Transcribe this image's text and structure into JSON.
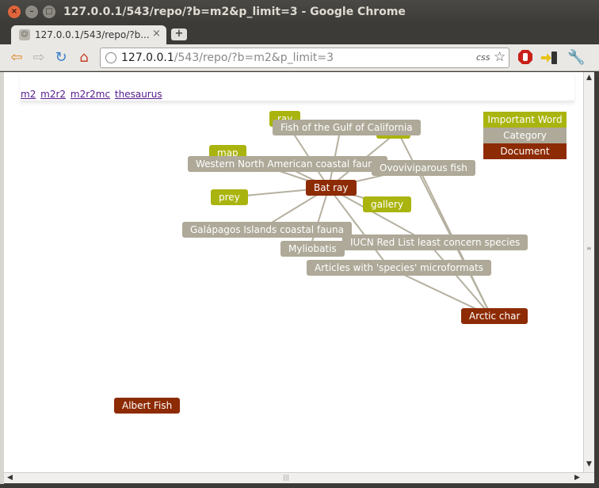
{
  "window": {
    "title": "127.0.0.1/543/repo/?b=m2&p_limit=3 - Google Chrome"
  },
  "tab": {
    "title": "127.0.0.1/543/repo/?b...",
    "close": "×",
    "new_tab": "+"
  },
  "omnibox": {
    "host": "127.0.0.1",
    "path": "/543/repo/?b=m2&p_limit=3",
    "badge": "css"
  },
  "nav_links": [
    "m2",
    "m2r2",
    "m2r2mc",
    "thesaurus"
  ],
  "legend": {
    "word": "Important Word",
    "category": "Category",
    "document": "Document [length]"
  },
  "colors": {
    "word": "#aab40e",
    "category": "#aea998",
    "document": "#8d2b04",
    "edge": "#b5b09f"
  },
  "graph": {
    "nodes": [
      {
        "id": "ray",
        "label": "ray",
        "type": "word"
      },
      {
        "id": "partial_word",
        "label": "",
        "type": "word"
      },
      {
        "id": "map",
        "label": "map",
        "type": "word"
      },
      {
        "id": "prey",
        "label": "prey",
        "type": "word"
      },
      {
        "id": "gallery",
        "label": "gallery",
        "type": "word"
      },
      {
        "id": "fish_gulf",
        "label": "Fish of the Gulf of California",
        "type": "cat"
      },
      {
        "id": "western",
        "label": "Western North American coastal fauna",
        "type": "cat"
      },
      {
        "id": "ovovivi",
        "label": "Ovoviviparous fish",
        "type": "cat"
      },
      {
        "id": "galapagos",
        "label": "Galápagos Islands coastal fauna",
        "type": "cat"
      },
      {
        "id": "myliobatis",
        "label": "Myliobatis",
        "type": "cat"
      },
      {
        "id": "iucn",
        "label": "IUCN Red List least concern species",
        "type": "cat"
      },
      {
        "id": "articles",
        "label": "Articles with 'species' microformats",
        "type": "cat"
      },
      {
        "id": "bat_ray",
        "label": "Bat ray",
        "type": "doc"
      },
      {
        "id": "arctic_char",
        "label": "Arctic char",
        "type": "doc"
      },
      {
        "id": "albert_fish",
        "label": "Albert Fish",
        "type": "doc"
      }
    ]
  }
}
